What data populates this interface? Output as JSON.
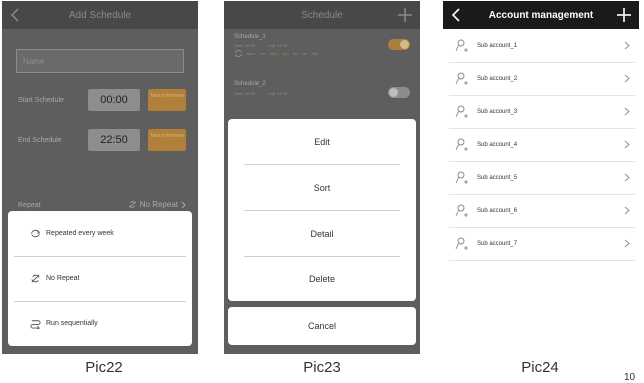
{
  "pic22": {
    "title": "Add Schedule",
    "name_placeholder": "Name",
    "start_label": "Start Schedule",
    "start_time": "00:00",
    "start_btn": "Take it /remove",
    "end_label": "End Schedule",
    "end_time": "22:50",
    "end_btn": "Take it /remove",
    "repeat_label": "Repeat",
    "repeat_value": "No Repeat",
    "options": [
      {
        "label": "Repeated every week",
        "icon": "loop-icon"
      },
      {
        "label": "No Repeat",
        "icon": "no-repeat-icon"
      },
      {
        "label": "Run sequentially",
        "icon": "sequential-icon"
      }
    ]
  },
  "pic23": {
    "title": "Schedule",
    "schedules": [
      {
        "name": "Schedule_1",
        "start": "Start: 06:30",
        "end": "End: 19:30",
        "days": [
          "Mon",
          "Tue",
          "Wed",
          "Thu",
          "Fri",
          "Sat",
          "Sun"
        ],
        "enabled": true
      },
      {
        "name": "Schedule_2",
        "start": "Start: 06:30",
        "end": "End: 19:30",
        "enabled": false
      }
    ],
    "menu": [
      "Edit",
      "Sort",
      "Detail",
      "Delete"
    ],
    "cancel": "Cancel"
  },
  "pic24": {
    "title": "Account management",
    "accounts": [
      "Sub account_1",
      "Sub account_2",
      "Sub account_3",
      "Sub account_4",
      "Sub account_5",
      "Sub account_6",
      "Sub account_7"
    ]
  },
  "captions": [
    "Pic22",
    "Pic23",
    "Pic24"
  ],
  "page_number": "10",
  "colors": {
    "accent_orange": "#e8932a",
    "dark_nav": "#1a1a1a",
    "overlay": "#5e5e5e"
  }
}
